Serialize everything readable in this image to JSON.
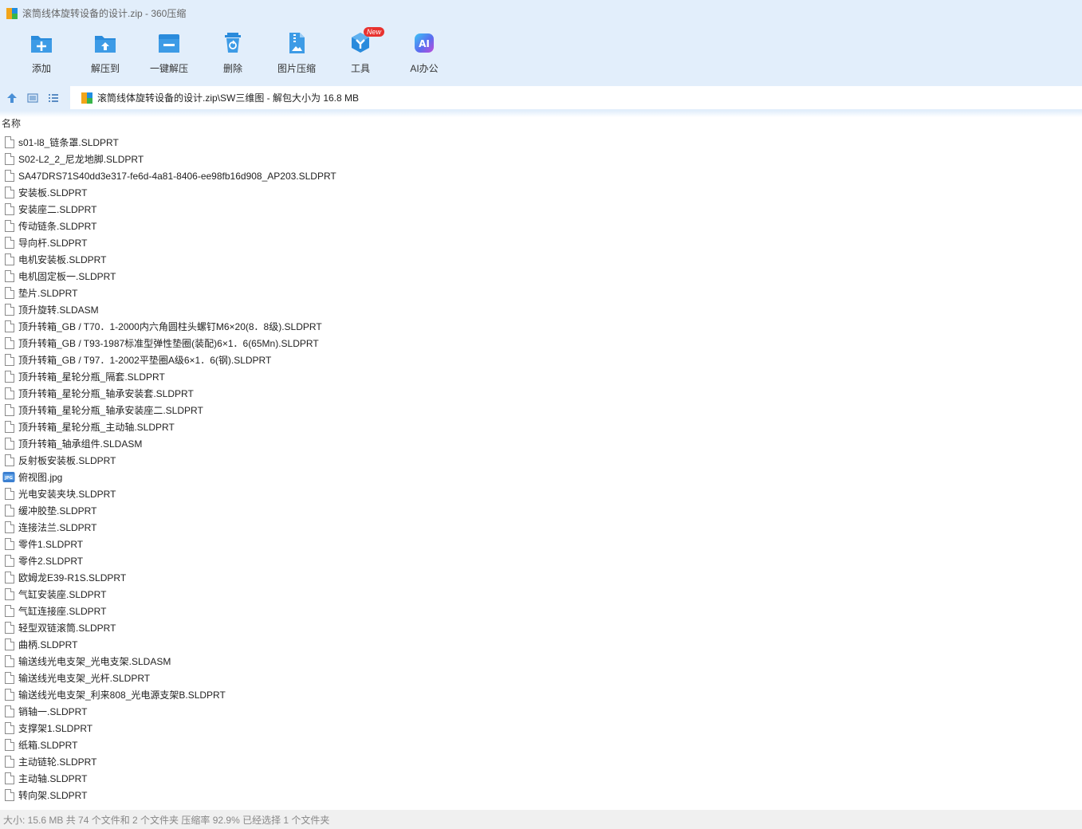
{
  "window": {
    "title": "滚筒线体旋转设备的设计.zip - 360压缩"
  },
  "toolbar": {
    "items": [
      {
        "label": "添加",
        "icon": "add-icon"
      },
      {
        "label": "解压到",
        "icon": "extract-to-icon"
      },
      {
        "label": "一键解压",
        "icon": "one-click-extract-icon"
      },
      {
        "label": "删除",
        "icon": "delete-icon"
      },
      {
        "label": "图片压缩",
        "icon": "image-compress-icon"
      },
      {
        "label": "工具",
        "icon": "tools-icon",
        "badge": "New"
      },
      {
        "label": "AI办公",
        "icon": "ai-office-icon",
        "glyph": "AI"
      }
    ]
  },
  "address": {
    "path": "滚筒线体旋转设备的设计.zip\\SW三维图 - 解包大小为 16.8 MB"
  },
  "list": {
    "column_name": "名称",
    "files": [
      {
        "name": "s01-l8_链条罩.SLDPRT",
        "type": "file"
      },
      {
        "name": "S02-L2_2_尼龙地脚.SLDPRT",
        "type": "file"
      },
      {
        "name": "SA47DRS71S40dd3e317-fe6d-4a81-8406-ee98fb16d908_AP203.SLDPRT",
        "type": "file"
      },
      {
        "name": "安装板.SLDPRT",
        "type": "file"
      },
      {
        "name": "安装座二.SLDPRT",
        "type": "file"
      },
      {
        "name": "传动链条.SLDPRT",
        "type": "file"
      },
      {
        "name": "导向杆.SLDPRT",
        "type": "file"
      },
      {
        "name": "电机安装板.SLDPRT",
        "type": "file"
      },
      {
        "name": "电机固定板一.SLDPRT",
        "type": "file"
      },
      {
        "name": "垫片.SLDPRT",
        "type": "file"
      },
      {
        "name": "顶升旋转.SLDASM",
        "type": "file"
      },
      {
        "name": "顶升转箱_GB / T70．1-2000内六角圆柱头螺钉M6×20(8．8级).SLDPRT",
        "type": "file"
      },
      {
        "name": "顶升转箱_GB / T93-1987标准型弹性垫圈(装配)6×1．6(65Mn).SLDPRT",
        "type": "file"
      },
      {
        "name": "顶升转箱_GB / T97．1-2002平垫圈A级6×1．6(钢).SLDPRT",
        "type": "file"
      },
      {
        "name": "顶升转箱_星轮分瓶_隔套.SLDPRT",
        "type": "file"
      },
      {
        "name": "顶升转箱_星轮分瓶_轴承安装套.SLDPRT",
        "type": "file"
      },
      {
        "name": "顶升转箱_星轮分瓶_轴承安装座二.SLDPRT",
        "type": "file"
      },
      {
        "name": "顶升转箱_星轮分瓶_主动轴.SLDPRT",
        "type": "file"
      },
      {
        "name": "顶升转箱_轴承组件.SLDASM",
        "type": "file"
      },
      {
        "name": "反射板安装板.SLDPRT",
        "type": "file"
      },
      {
        "name": "俯视图.jpg",
        "type": "image"
      },
      {
        "name": "光电安装夹块.SLDPRT",
        "type": "file"
      },
      {
        "name": "缓冲胶垫.SLDPRT",
        "type": "file"
      },
      {
        "name": "连接法兰.SLDPRT",
        "type": "file"
      },
      {
        "name": "零件1.SLDPRT",
        "type": "file"
      },
      {
        "name": "零件2.SLDPRT",
        "type": "file"
      },
      {
        "name": "欧姆龙E39-R1S.SLDPRT",
        "type": "file"
      },
      {
        "name": "气缸安装座.SLDPRT",
        "type": "file"
      },
      {
        "name": "气缸连接座.SLDPRT",
        "type": "file"
      },
      {
        "name": "轻型双链滚筒.SLDPRT",
        "type": "file"
      },
      {
        "name": "曲柄.SLDPRT",
        "type": "file"
      },
      {
        "name": "输送线光电支架_光电支架.SLDASM",
        "type": "file"
      },
      {
        "name": "输送线光电支架_光杆.SLDPRT",
        "type": "file"
      },
      {
        "name": "输送线光电支架_利来808_光电源支架B.SLDPRT",
        "type": "file"
      },
      {
        "name": "销轴一.SLDPRT",
        "type": "file"
      },
      {
        "name": "支撑架1.SLDPRT",
        "type": "file"
      },
      {
        "name": "纸箱.SLDPRT",
        "type": "file"
      },
      {
        "name": "主动链轮.SLDPRT",
        "type": "file"
      },
      {
        "name": "主动轴.SLDPRT",
        "type": "file"
      },
      {
        "name": "转向架.SLDPRT",
        "type": "file"
      }
    ]
  },
  "status": {
    "text": "大小: 15.6 MB 共 74 个文件和 2 个文件夹 压缩率 92.9% 已经选择 1 个文件夹"
  },
  "colors": {
    "chrome_bg": "#e2eefb",
    "icon_blue": "#2a8bdc",
    "badge_red": "#e8322f"
  }
}
